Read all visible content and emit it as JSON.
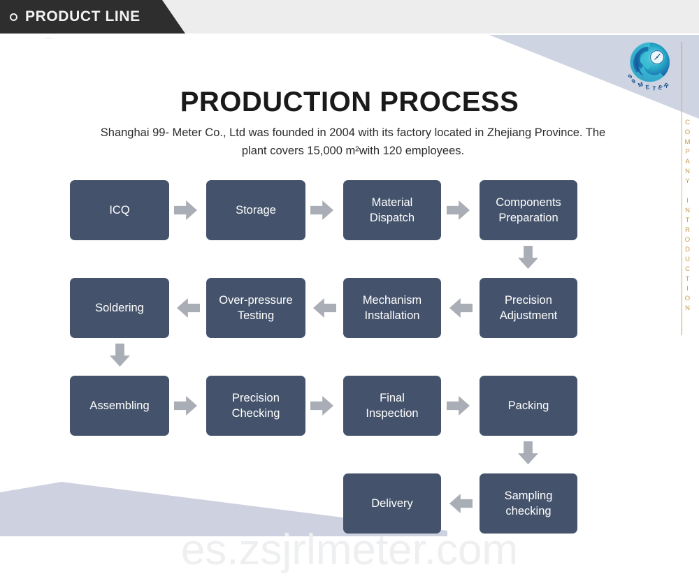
{
  "banner": {
    "label": "PRODUCT LINE",
    "bullet_icon": "circle-outline-icon",
    "background_color": "#2e2e2e",
    "text_color": "#f2f2f2"
  },
  "brand": {
    "logo_icon": "99-meter-swirl-logo-icon",
    "logo_text": "99 METER",
    "vertical_caption": "COMPANY INTRODUCTION",
    "accent_color": "#c49a49"
  },
  "heading": {
    "title": "PRODUCTION PROCESS",
    "subtitle": "Shanghai 99- Meter Co., Ltd was founded in 2004 with its factory located in Zhejiang Province. The plant covers 15,000 m²with 120 employees."
  },
  "theme": {
    "box_color": "#44536b",
    "arrow_color": "#a9adb6",
    "decor_color": "#ccd2e0",
    "page_background": "#ffffff"
  },
  "flow": {
    "rows": [
      {
        "direction": "right",
        "steps": [
          {
            "label": "ICQ"
          },
          {
            "label": "Storage"
          },
          {
            "label": "Material\nDispatch"
          },
          {
            "label": "Components\nPreparation"
          }
        ]
      },
      {
        "direction": "left",
        "steps": [
          {
            "label": "Soldering"
          },
          {
            "label": "Over-pressure\nTesting"
          },
          {
            "label": "Mechanism\nInstallation"
          },
          {
            "label": "Precision\nAdjustment"
          }
        ]
      },
      {
        "direction": "right",
        "steps": [
          {
            "label": "Assembling"
          },
          {
            "label": "Precision\nChecking"
          },
          {
            "label": "Final\nInspection"
          },
          {
            "label": "Packing"
          }
        ]
      },
      {
        "direction": "left",
        "steps": [
          {
            "label": "Delivery"
          },
          {
            "label": "Sampling\nchecking"
          }
        ]
      }
    ],
    "connectors": [
      {
        "name": "arrow-row1-icq-to-storage",
        "icon": "arrow-right-icon"
      },
      {
        "name": "arrow-row1-storage-to-material-dispatch",
        "icon": "arrow-right-icon"
      },
      {
        "name": "arrow-row1-material-dispatch-to-components-preparation",
        "icon": "arrow-right-icon"
      },
      {
        "name": "arrow-components-preparation-to-precision-adjustment",
        "icon": "arrow-down-icon"
      },
      {
        "name": "arrow-row2-precision-adjustment-to-mechanism-installation",
        "icon": "arrow-left-icon"
      },
      {
        "name": "arrow-row2-mechanism-installation-to-over-pressure-testing",
        "icon": "arrow-left-icon"
      },
      {
        "name": "arrow-row2-over-pressure-testing-to-soldering",
        "icon": "arrow-left-icon"
      },
      {
        "name": "arrow-soldering-to-assembling",
        "icon": "arrow-down-icon"
      },
      {
        "name": "arrow-row3-assembling-to-precision-checking",
        "icon": "arrow-right-icon"
      },
      {
        "name": "arrow-row3-precision-checking-to-final-inspection",
        "icon": "arrow-right-icon"
      },
      {
        "name": "arrow-row3-final-inspection-to-packing",
        "icon": "arrow-right-icon"
      },
      {
        "name": "arrow-packing-to-sampling-checking",
        "icon": "arrow-down-icon"
      },
      {
        "name": "arrow-row4-sampling-checking-to-delivery",
        "icon": "arrow-left-icon"
      }
    ]
  },
  "watermark": {
    "text": "es.zsjrlmeter.com"
  }
}
